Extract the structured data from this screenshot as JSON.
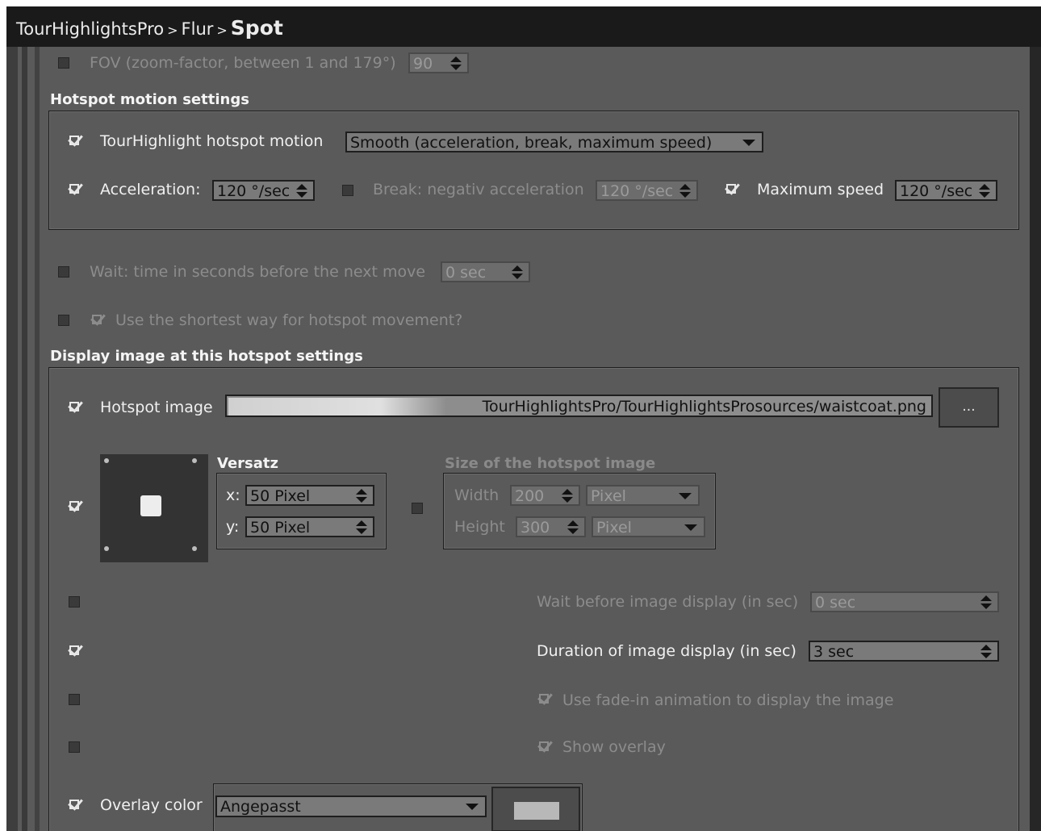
{
  "breadcrumb": {
    "root": "TourHighlightsPro",
    "sep": ">",
    "middle": "Flur",
    "current": "Spot"
  },
  "fov": {
    "label": "FOV (zoom-factor, between 1 and 179°)",
    "value": "90",
    "checked": false,
    "enabled": false
  },
  "motion": {
    "header": "Hotspot motion settings",
    "hotspot_motion": {
      "label": "TourHighlight hotspot motion",
      "value": "Smooth (acceleration, break, maximum speed)",
      "checked": true
    },
    "acceleration": {
      "label": "Acceleration:",
      "value": "120 °/sec",
      "checked": true
    },
    "break": {
      "label": "Break: negativ acceleration",
      "value": "120 °/sec",
      "checked": false,
      "enabled": false
    },
    "max_speed": {
      "label": "Maximum speed",
      "value": "120 °/sec",
      "checked": true
    }
  },
  "wait": {
    "label": "Wait: time in seconds before the next move",
    "value": "0 sec",
    "checked": false,
    "enabled": false
  },
  "shortest": {
    "label": "Use the shortest way for hotspot movement?",
    "checked": false,
    "inner_checked": true,
    "enabled": false
  },
  "display": {
    "header": "Display image at this hotspot settings",
    "hotspot_image": {
      "label": "Hotspot image",
      "value": "TourHighlightsPro/TourHighlightsProsources/waistcoat.png",
      "browse_label": "...",
      "checked": true
    },
    "versatz": {
      "header": "Versatz",
      "x_label": "x:",
      "x_value": "50 Pixel",
      "y_label": "y:",
      "y_value": "50 Pixel",
      "checked": true
    },
    "size": {
      "header": "Size of the hotspot image",
      "width_label": "Width",
      "width_value": "200",
      "width_unit": "Pixel",
      "height_label": "Height",
      "height_value": "300",
      "height_unit": "Pixel",
      "checked": false,
      "enabled": false
    },
    "wait_before": {
      "label": "Wait before image display (in sec)",
      "value": "0 sec",
      "checked": false,
      "enabled": false
    },
    "duration": {
      "label": "Duration of image display (in sec)",
      "value": "3 sec",
      "checked": true
    },
    "fade_in": {
      "label": "Use fade-in animation to display the image",
      "checked": false,
      "inner_checked": true,
      "enabled": false
    },
    "show_overlay": {
      "label": "Show overlay",
      "checked": false,
      "inner_checked": true,
      "enabled": false
    },
    "overlay_color": {
      "label": "Overlay color",
      "value": "Angepasst",
      "checked": true,
      "swatch_color": "#b8b8b8"
    }
  },
  "colors": {
    "panel": "#5a5a5a",
    "titlebar": "#1a1a1a",
    "text": "#f0f0f0",
    "disabled_text": "#8c8c8c"
  }
}
